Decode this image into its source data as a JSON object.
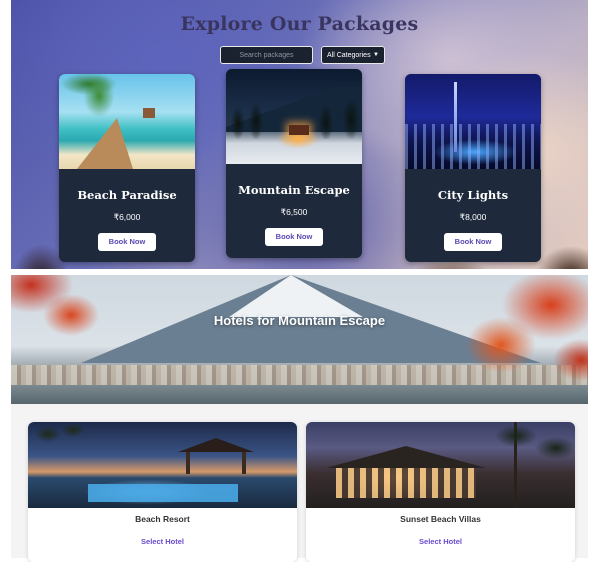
{
  "explore": {
    "title": "Explore Our Packages",
    "search_placeholder": "Search packages",
    "category_selected": "All Categories"
  },
  "packages": [
    {
      "name": "Beach Paradise",
      "price": "₹6,000",
      "button": "Book Now",
      "image": "beach-pier-photo"
    },
    {
      "name": "Mountain Escape",
      "price": "₹6,500",
      "button": "Book Now",
      "image": "snowy-cabin-night-photo"
    },
    {
      "name": "City Lights",
      "price": "₹8,000",
      "button": "Book Now",
      "image": "city-skyline-night-photo"
    }
  ],
  "hero": {
    "title": "Hotels for Mountain Escape",
    "image": "mount-fuji-autumn-photo"
  },
  "hotels": [
    {
      "name": "Beach Resort",
      "action": "Select Hotel",
      "image": "resort-pool-gazebo-photo"
    },
    {
      "name": "Sunset Beach Villas",
      "action": "Select Hotel",
      "image": "villa-sunset-palms-photo"
    }
  ],
  "colors": {
    "card_bg": "#1e293b",
    "accent": "#5a4ab5",
    "link": "#6a4ad0"
  }
}
